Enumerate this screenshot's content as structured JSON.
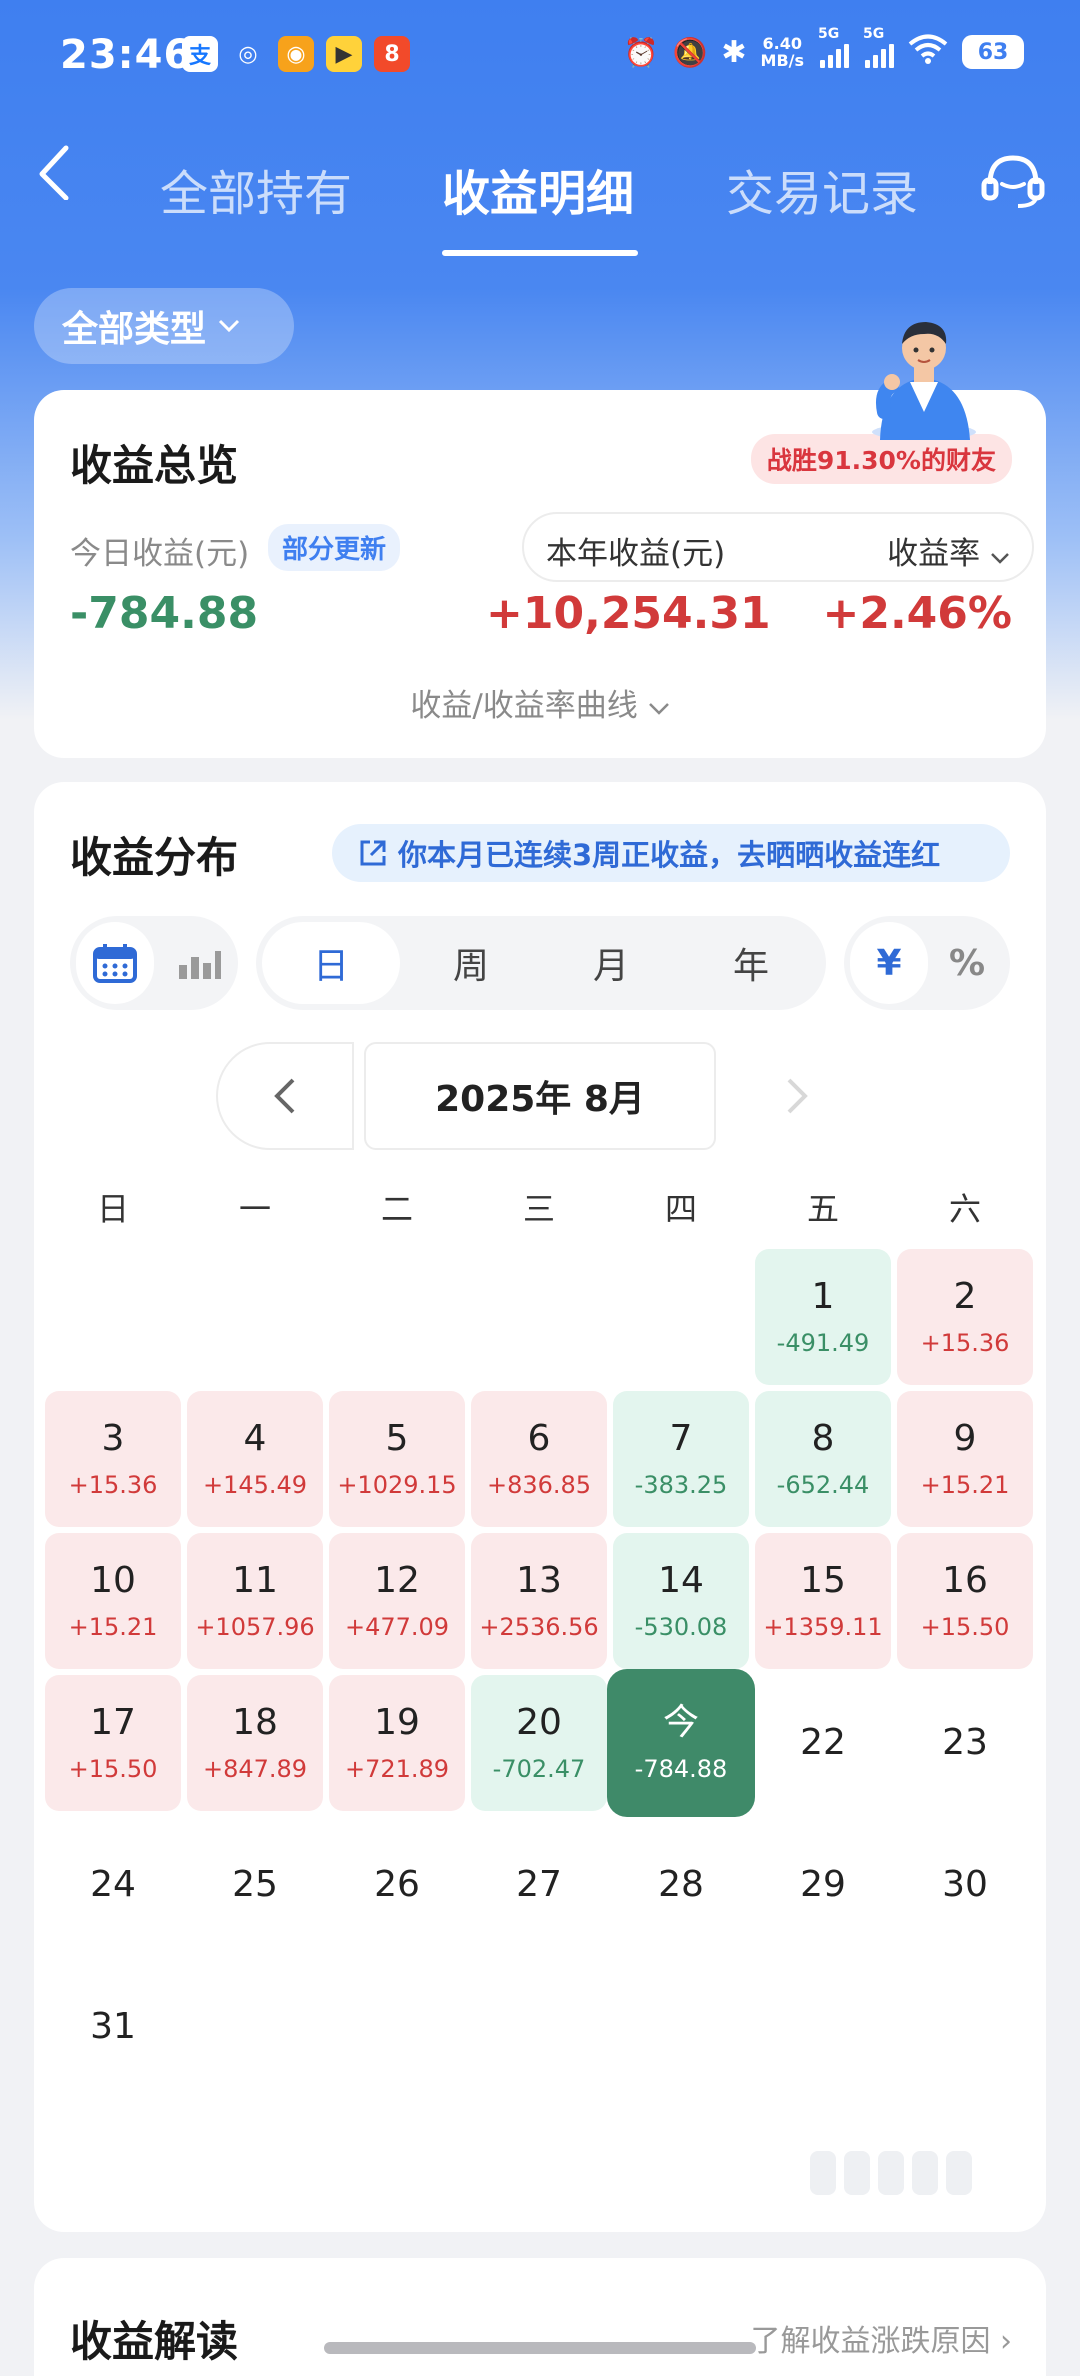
{
  "status_bar": {
    "time": "23:46",
    "speed_value": "6.40",
    "speed_unit": "MB/s",
    "net1": "5G",
    "net2": "5G",
    "battery": "63"
  },
  "nav": {
    "tabs": [
      "全部持有",
      "收益明细",
      "交易记录"
    ],
    "active_tab": 1
  },
  "filter": {
    "type_label": "全部类型"
  },
  "overview": {
    "title": "收益总览",
    "beat_badge": "战胜91.30%的财友",
    "today_label": "今日收益(元)",
    "partial_badge": "部分更新",
    "year_label": "本年收益(元)",
    "rate_label": "收益率",
    "today_value": "-784.88",
    "year_value": "+10,254.31",
    "rate_value": "+2.46%",
    "curve_link": "收益/收益率曲线"
  },
  "distribution": {
    "title": "收益分布",
    "streak_banner": "你本月已连续3周正收益，去晒晒收益连红",
    "period_options": [
      "日",
      "周",
      "月",
      "年"
    ],
    "unit_options": [
      "¥",
      "%"
    ],
    "month_label": "2025年 8月",
    "weekdays": [
      "日",
      "一",
      "二",
      "三",
      "四",
      "五",
      "六"
    ],
    "first_weekday_index": 5,
    "days": [
      {
        "d": "1",
        "v": "-491.49",
        "s": "neg"
      },
      {
        "d": "2",
        "v": "+15.36",
        "s": "pos"
      },
      {
        "d": "3",
        "v": "+15.36",
        "s": "pos"
      },
      {
        "d": "4",
        "v": "+145.49",
        "s": "pos"
      },
      {
        "d": "5",
        "v": "+1029.15",
        "s": "pos"
      },
      {
        "d": "6",
        "v": "+836.85",
        "s": "pos"
      },
      {
        "d": "7",
        "v": "-383.25",
        "s": "neg"
      },
      {
        "d": "8",
        "v": "-652.44",
        "s": "neg"
      },
      {
        "d": "9",
        "v": "+15.21",
        "s": "pos"
      },
      {
        "d": "10",
        "v": "+15.21",
        "s": "pos"
      },
      {
        "d": "11",
        "v": "+1057.96",
        "s": "pos"
      },
      {
        "d": "12",
        "v": "+477.09",
        "s": "pos"
      },
      {
        "d": "13",
        "v": "+2536.56",
        "s": "pos"
      },
      {
        "d": "14",
        "v": "-530.08",
        "s": "neg"
      },
      {
        "d": "15",
        "v": "+1359.11",
        "s": "pos"
      },
      {
        "d": "16",
        "v": "+15.50",
        "s": "pos"
      },
      {
        "d": "17",
        "v": "+15.50",
        "s": "pos"
      },
      {
        "d": "18",
        "v": "+847.89",
        "s": "pos"
      },
      {
        "d": "19",
        "v": "+721.89",
        "s": "pos"
      },
      {
        "d": "20",
        "v": "-702.47",
        "s": "neg"
      },
      {
        "d": "今",
        "v": "-784.88",
        "s": "today"
      },
      {
        "d": "22",
        "v": "",
        "s": "none"
      },
      {
        "d": "23",
        "v": "",
        "s": "none"
      },
      {
        "d": "24",
        "v": "",
        "s": "none"
      },
      {
        "d": "25",
        "v": "",
        "s": "none"
      },
      {
        "d": "26",
        "v": "",
        "s": "none"
      },
      {
        "d": "27",
        "v": "",
        "s": "none"
      },
      {
        "d": "28",
        "v": "",
        "s": "none"
      },
      {
        "d": "29",
        "v": "",
        "s": "none"
      },
      {
        "d": "30",
        "v": "",
        "s": "none"
      },
      {
        "d": "31",
        "v": "",
        "s": "none"
      }
    ]
  },
  "interpretation": {
    "title": "收益解读",
    "link": "了解收益涨跌原因 ›"
  },
  "colors": {
    "brand_blue": "#3f7ff0",
    "gain_red": "#d13a3a",
    "loss_green": "#3a8f66",
    "gain_bg": "#fbe9ea",
    "loss_bg": "#e3f5ee",
    "today_bg": "#3f8a69"
  }
}
